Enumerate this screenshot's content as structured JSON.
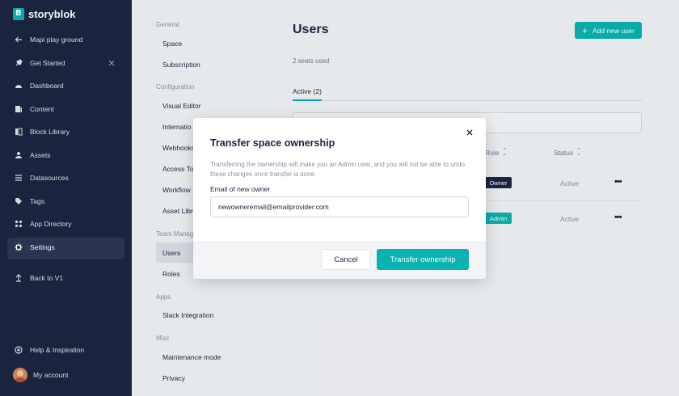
{
  "brand": {
    "name": "storyblok"
  },
  "nav": {
    "back_label": "Mapi play ground",
    "items": [
      {
        "label": "Get Started",
        "icon": "rocket-icon"
      },
      {
        "label": "Dashboard",
        "icon": "dashboard-icon"
      },
      {
        "label": "Content",
        "icon": "content-icon"
      },
      {
        "label": "Block Library",
        "icon": "block-library-icon"
      },
      {
        "label": "Assets",
        "icon": "assets-icon"
      },
      {
        "label": "Datasources",
        "icon": "datasources-icon"
      },
      {
        "label": "Tags",
        "icon": "tag-icon"
      },
      {
        "label": "App Directory",
        "icon": "app-directory-icon"
      },
      {
        "label": "Settings",
        "icon": "gear-icon"
      },
      {
        "label": "Back to V1",
        "icon": "back-v1-icon"
      }
    ],
    "help_label": "Help & Inspiration",
    "account_label": "My account"
  },
  "settings_menu": {
    "groups": [
      {
        "heading": "General",
        "items": [
          "Space",
          "Subscription"
        ]
      },
      {
        "heading": "Configuration",
        "items": [
          "Visual Editor",
          "Internatio",
          "Webhooks",
          "Access Tok",
          "Workflow",
          "Asset Libra"
        ]
      },
      {
        "heading": "Team Manag",
        "items": [
          "Users",
          "Roles"
        ]
      },
      {
        "heading": "Apps",
        "items": [
          "Slack Integration"
        ]
      },
      {
        "heading": "Misc",
        "items": [
          "Maintenance mode",
          "Privacy"
        ]
      }
    ],
    "active": "Users"
  },
  "main": {
    "title": "Users",
    "seats": "2 seats used",
    "add_button": "Add new user",
    "tab_active": "Active (2)",
    "columns": {
      "role": "Role",
      "status": "Status"
    },
    "rows": [
      {
        "role": "Owner",
        "status": "Active"
      },
      {
        "role": "Admin",
        "status": "Active"
      }
    ]
  },
  "modal": {
    "title": "Transfer space ownership",
    "description": "Transferring the ownership will make you an Admin user, and you will not be able to undo these changes once transfer is done.",
    "email_label": "Email of new owner",
    "email_value": "newowneremail@emailprovider.com",
    "cancel": "Cancel",
    "confirm": "Transfer ownership"
  },
  "colors": {
    "accent": "#09b3af",
    "nav_bg": "#1b243f",
    "owner_badge": "#1b243f",
    "admin_badge": "#09b3af"
  }
}
